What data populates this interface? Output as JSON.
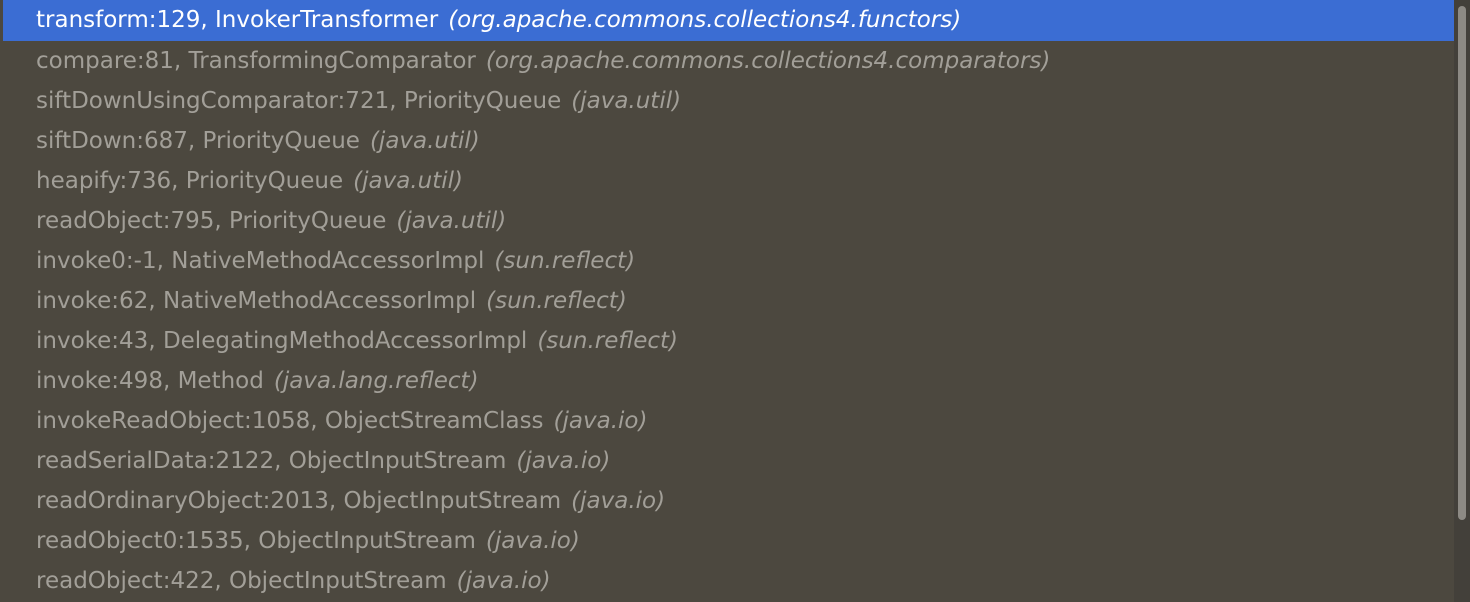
{
  "frames": [
    {
      "method": "transform:129, InvokerTransformer",
      "pkg": "(org.apache.commons.collections4.functors)",
      "selected": true
    },
    {
      "method": "compare:81, TransformingComparator",
      "pkg": "(org.apache.commons.collections4.comparators)"
    },
    {
      "method": "siftDownUsingComparator:721, PriorityQueue",
      "pkg": "(java.util)"
    },
    {
      "method": "siftDown:687, PriorityQueue",
      "pkg": "(java.util)"
    },
    {
      "method": "heapify:736, PriorityQueue",
      "pkg": "(java.util)"
    },
    {
      "method": "readObject:795, PriorityQueue",
      "pkg": "(java.util)"
    },
    {
      "method": "invoke0:-1, NativeMethodAccessorImpl",
      "pkg": "(sun.reflect)"
    },
    {
      "method": "invoke:62, NativeMethodAccessorImpl",
      "pkg": "(sun.reflect)"
    },
    {
      "method": "invoke:43, DelegatingMethodAccessorImpl",
      "pkg": "(sun.reflect)"
    },
    {
      "method": "invoke:498, Method",
      "pkg": "(java.lang.reflect)"
    },
    {
      "method": "invokeReadObject:1058, ObjectStreamClass",
      "pkg": "(java.io)"
    },
    {
      "method": "readSerialData:2122, ObjectInputStream",
      "pkg": "(java.io)"
    },
    {
      "method": "readOrdinaryObject:2013, ObjectInputStream",
      "pkg": "(java.io)"
    },
    {
      "method": "readObject0:1535, ObjectInputStream",
      "pkg": "(java.io)"
    },
    {
      "method": "readObject:422, ObjectInputStream",
      "pkg": "(java.io)"
    }
  ],
  "colors": {
    "background": "#4c483f",
    "selection": "#3b6dd3",
    "text": "#a29f98",
    "selected_text": "#ffffff",
    "scroll_thumb": "#8d8a84"
  }
}
